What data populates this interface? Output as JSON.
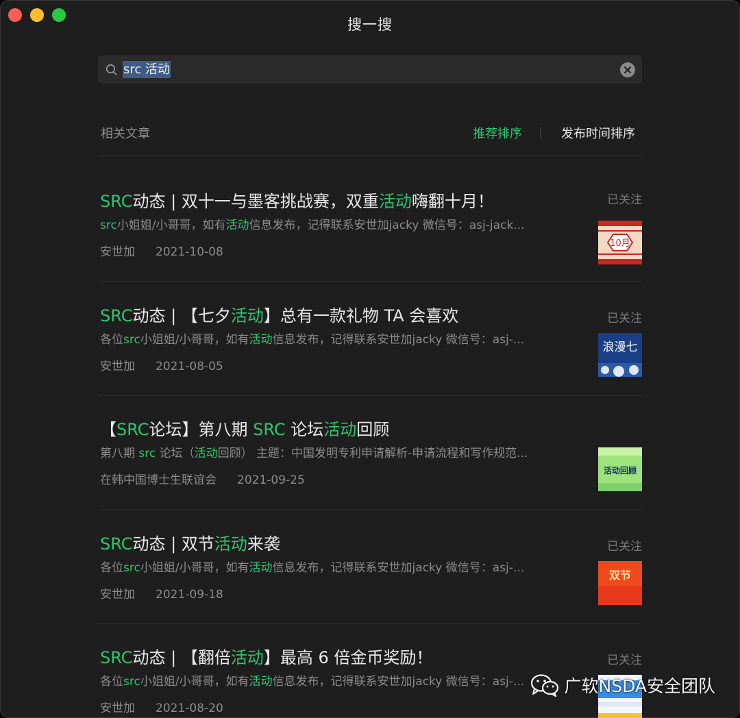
{
  "window": {
    "title": "搜一搜"
  },
  "search": {
    "value": "src 活动"
  },
  "section": {
    "label": "相关文章",
    "sort_recommend": "推荐排序",
    "sort_time": "发布时间排序"
  },
  "colors": {
    "accent": "#2ec56f",
    "background": "#1e1e1e",
    "selection": "#3f5c86"
  },
  "items": [
    {
      "title_parts": [
        {
          "text": "SRC",
          "hl": true
        },
        {
          "text": "动态 | 双十一与墨客挑战赛，双重",
          "hl": false
        },
        {
          "text": "活动",
          "hl": true
        },
        {
          "text": "嗨翻十月！",
          "hl": false
        }
      ],
      "snippet_parts": [
        {
          "text": "src",
          "hl": true
        },
        {
          "text": "小姐姐/小哥哥，如有",
          "hl": false
        },
        {
          "text": "活动",
          "hl": true
        },
        {
          "text": "信息发布，记得联系安世加jacky 微信号：asj-jack...",
          "hl": false
        }
      ],
      "source": "安世加",
      "date": "2021-10-08",
      "follow": "已关注",
      "thumb_text": "10月"
    },
    {
      "title_parts": [
        {
          "text": "SRC",
          "hl": true
        },
        {
          "text": "动态 | 【七夕",
          "hl": false
        },
        {
          "text": "活动",
          "hl": true
        },
        {
          "text": "】总有一款礼物 TA 会喜欢",
          "hl": false
        }
      ],
      "snippet_parts": [
        {
          "text": "各位",
          "hl": false
        },
        {
          "text": "src",
          "hl": true
        },
        {
          "text": "小姐姐/小哥哥，如有",
          "hl": false
        },
        {
          "text": "活动",
          "hl": true
        },
        {
          "text": "信息发布，记得联系安世加jacky 微信号：asj-...",
          "hl": false
        }
      ],
      "source": "安世加",
      "date": "2021-08-05",
      "follow": "已关注",
      "thumb_text": "浪漫七"
    },
    {
      "title_parts": [
        {
          "text": "【",
          "hl": false
        },
        {
          "text": "SRC",
          "hl": true
        },
        {
          "text": "论坛】第八期 ",
          "hl": false
        },
        {
          "text": "SRC",
          "hl": true
        },
        {
          "text": " 论坛",
          "hl": false
        },
        {
          "text": "活动",
          "hl": true
        },
        {
          "text": "回顾",
          "hl": false
        }
      ],
      "snippet_parts": [
        {
          "text": "第八期 ",
          "hl": false
        },
        {
          "text": "src",
          "hl": true
        },
        {
          "text": " 论坛（",
          "hl": false
        },
        {
          "text": "活动",
          "hl": true
        },
        {
          "text": "回顾） 主题：中国发明专利申请解析-申请流程和写作规范...",
          "hl": false
        }
      ],
      "source": "在韩中国博士生联谊会",
      "date": "2021-09-25",
      "follow": "",
      "thumb_text": "活动回顾"
    },
    {
      "title_parts": [
        {
          "text": "SRC",
          "hl": true
        },
        {
          "text": "动态 | 双节",
          "hl": false
        },
        {
          "text": "活动",
          "hl": true
        },
        {
          "text": "来袭",
          "hl": false
        }
      ],
      "snippet_parts": [
        {
          "text": "各位",
          "hl": false
        },
        {
          "text": "src",
          "hl": true
        },
        {
          "text": "小姐姐/小哥哥，如有",
          "hl": false
        },
        {
          "text": "活动",
          "hl": true
        },
        {
          "text": "信息发布，记得联系安世加jacky 微信号：asj-...",
          "hl": false
        }
      ],
      "source": "安世加",
      "date": "2021-09-18",
      "follow": "已关注",
      "thumb_text": "双节"
    },
    {
      "title_parts": [
        {
          "text": "SRC",
          "hl": true
        },
        {
          "text": "动态 | 【翻倍",
          "hl": false
        },
        {
          "text": "活动",
          "hl": true
        },
        {
          "text": "】最高 6 倍金币奖励！",
          "hl": false
        }
      ],
      "snippet_parts": [
        {
          "text": "各位",
          "hl": false
        },
        {
          "text": "src",
          "hl": true
        },
        {
          "text": "小姐姐/小哥哥，如有",
          "hl": false
        },
        {
          "text": "活动",
          "hl": true
        },
        {
          "text": "信息发布，记得联系安世加jacky 微信号：asj-...",
          "hl": false
        }
      ],
      "source": "安世加",
      "date": "2021-08-20",
      "follow": "已关注",
      "thumb_text": ""
    }
  ],
  "watermark": {
    "text": "广软NSDA安全团队",
    "icon": "wechat-icon"
  }
}
